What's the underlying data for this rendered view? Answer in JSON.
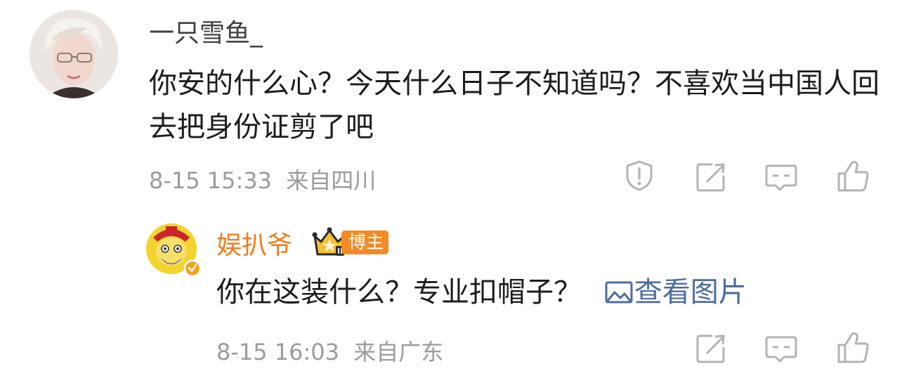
{
  "comment": {
    "username": "一只雪鱼_",
    "text": "你安的什么心？今天什么日子不知道吗？不喜欢当中国人回去把身份证剪了吧",
    "time": "8-15 15:33",
    "location": "来自四川"
  },
  "reply": {
    "username": "娱扒爷",
    "badge_label": "博主",
    "text": "你在这装什么？专业扣帽子？",
    "view_image_label": "查看图片",
    "time": "8-15 16:03",
    "location": "来自广东"
  },
  "colors": {
    "author_name": "#f07d20",
    "link": "#4c6c9c",
    "meta": "#9b9b9b",
    "icon": "#b3b3b3"
  },
  "icons": [
    "report-icon",
    "repost-icon",
    "reply-icon",
    "like-icon",
    "image-icon",
    "crown-icon",
    "verified-icon"
  ]
}
